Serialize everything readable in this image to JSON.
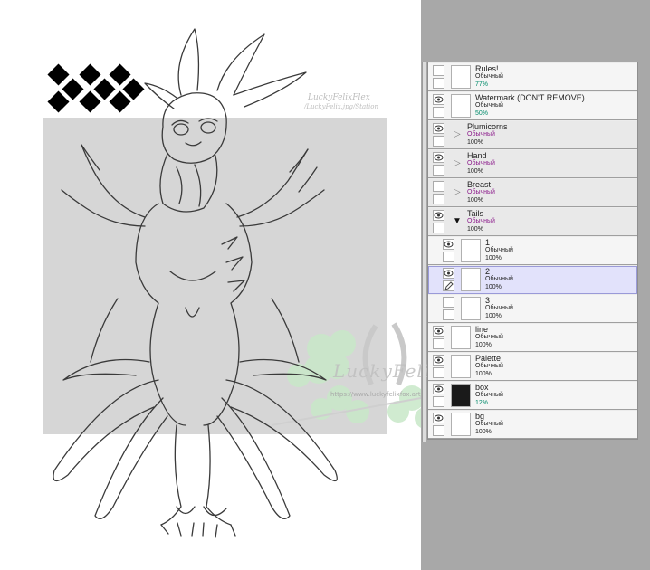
{
  "canvas": {
    "watermark_small_1": "LuckyFelixFlex",
    "watermark_small_2": "/LuckyFelix.jpg/Station",
    "watermark_big": "LuckyFelixFlex",
    "watermark_url": "https://www.luckyfelixfox.art/"
  },
  "layers": [
    {
      "name": "Rules!",
      "mode": "Обычный",
      "opacity": "77%",
      "visible": false,
      "folder": false
    },
    {
      "name": "Watermark (DON'T REMOVE)",
      "mode": "Обычный",
      "opacity": "50%",
      "visible": true,
      "folder": false
    },
    {
      "name": "Plumicorns",
      "mode": "Обычный",
      "opacity": "100%",
      "visible": true,
      "folder": true
    },
    {
      "name": "Hand",
      "mode": "Обычный",
      "opacity": "100%",
      "visible": true,
      "folder": true
    },
    {
      "name": "Breast",
      "mode": "Обычный",
      "opacity": "100%",
      "visible": false,
      "folder": true
    },
    {
      "name": "Tails",
      "mode": "Обычный",
      "opacity": "100%",
      "visible": true,
      "folder": true
    },
    {
      "name": "1",
      "mode": "Обычный",
      "opacity": "100%",
      "visible": true,
      "folder": false
    },
    {
      "name": "2",
      "mode": "Обычный",
      "opacity": "100%",
      "visible": true,
      "folder": false,
      "selected": true
    },
    {
      "name": "3",
      "mode": "Обычный",
      "opacity": "100%",
      "visible": false,
      "folder": false
    },
    {
      "name": "line",
      "mode": "Обычный",
      "opacity": "100%",
      "visible": true,
      "folder": false
    },
    {
      "name": "Palette",
      "mode": "Обычный",
      "opacity": "100%",
      "visible": true,
      "folder": false
    },
    {
      "name": "box",
      "mode": "Обычный",
      "opacity": "12%",
      "visible": true,
      "folder": false
    },
    {
      "name": "bg",
      "mode": "Обычный",
      "opacity": "100%",
      "visible": true,
      "folder": false
    }
  ],
  "colors": {
    "mode_folder": "#8b1a8b",
    "opacity_highlight": "#008a6a",
    "selected_bg": "#e2e2fb"
  }
}
